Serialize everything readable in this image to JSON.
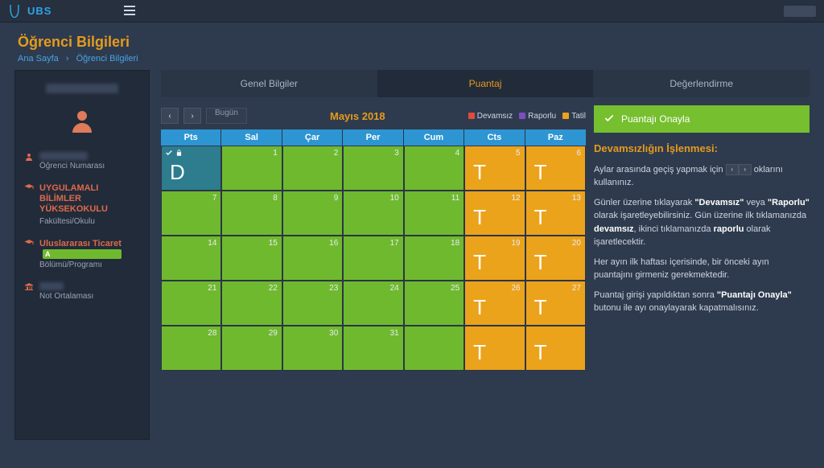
{
  "brand": "UBS",
  "page_title": "Öğrenci Bilgileri",
  "breadcrumb": {
    "home": "Ana Sayfa",
    "current": "Öğrenci Bilgileri"
  },
  "sidebar": {
    "student_number_label": "Öğrenci Numarası",
    "faculty_main": "UYGULAMALI BİLİMLER YÜKSEKOKULU",
    "faculty_sub": "Fakültesi/Okulu",
    "dept_main": "Uluslararası Ticaret",
    "dept_badge": "A",
    "dept_sub": "Bölümü/Programı",
    "gpa_sub": "Not Ortalaması"
  },
  "tabs": {
    "t1": "Genel Bilgiler",
    "t2": "Puantaj",
    "t3": "Değerlendirme"
  },
  "calendar": {
    "today_label": "Bugün",
    "title": "Mayıs 2018",
    "legend": {
      "devamsiz": "Devamsız",
      "raporlu": "Raporlu",
      "tatil": "Tatil"
    },
    "days": {
      "mon": "Pts",
      "tue": "Sal",
      "wed": "Çar",
      "thu": "Per",
      "fri": "Cum",
      "sat": "Cts",
      "sun": "Paz"
    },
    "cells": [
      {
        "n": "",
        "cls": "teal",
        "mark": "D",
        "lock": true
      },
      {
        "n": "1",
        "cls": "green"
      },
      {
        "n": "2",
        "cls": "green"
      },
      {
        "n": "3",
        "cls": "green"
      },
      {
        "n": "4",
        "cls": "green"
      },
      {
        "n": "5",
        "cls": "orange",
        "mark": "T"
      },
      {
        "n": "6",
        "cls": "orange",
        "mark": "T"
      },
      {
        "n": "7",
        "cls": "green"
      },
      {
        "n": "8",
        "cls": "green"
      },
      {
        "n": "9",
        "cls": "green"
      },
      {
        "n": "10",
        "cls": "green"
      },
      {
        "n": "11",
        "cls": "green"
      },
      {
        "n": "12",
        "cls": "orange",
        "mark": "T"
      },
      {
        "n": "13",
        "cls": "orange",
        "mark": "T"
      },
      {
        "n": "14",
        "cls": "green"
      },
      {
        "n": "15",
        "cls": "green"
      },
      {
        "n": "16",
        "cls": "green"
      },
      {
        "n": "17",
        "cls": "green"
      },
      {
        "n": "18",
        "cls": "green"
      },
      {
        "n": "19",
        "cls": "orange",
        "mark": "T"
      },
      {
        "n": "20",
        "cls": "orange",
        "mark": "T"
      },
      {
        "n": "21",
        "cls": "green"
      },
      {
        "n": "22",
        "cls": "green"
      },
      {
        "n": "23",
        "cls": "green"
      },
      {
        "n": "24",
        "cls": "green"
      },
      {
        "n": "25",
        "cls": "green"
      },
      {
        "n": "26",
        "cls": "orange",
        "mark": "T"
      },
      {
        "n": "27",
        "cls": "orange",
        "mark": "T"
      },
      {
        "n": "28",
        "cls": "green"
      },
      {
        "n": "29",
        "cls": "green"
      },
      {
        "n": "30",
        "cls": "green"
      },
      {
        "n": "31",
        "cls": "green"
      },
      {
        "n": "",
        "cls": "green"
      },
      {
        "n": "",
        "cls": "orange",
        "mark": "T"
      },
      {
        "n": "",
        "cls": "orange",
        "mark": "T"
      }
    ]
  },
  "approve_label": "Puantajı Onayla",
  "help": {
    "title": "Devamsızlığın İşlenmesi:",
    "p1a": "Aylar arasında geçiş yapmak için ",
    "p1b": " oklarını kullanınız.",
    "p2": "Günler üzerine tıklayarak \"Devamsız\" veya \"Raporlu\" olarak işaretleyebilirsiniz. Gün üzerine ilk tıklamanızda devamsız, ikinci tıklamanızda raporlu olarak işaretlecektir.",
    "p3": "Her ayın ilk haftası içerisinde, bir önceki ayın puantajını girmeniz gerekmektedir.",
    "p4": "Puantaj girişi yapıldıktan sonra \"Puantajı Onayla\" butonu ile ayı onaylayarak kapatmalısınız."
  }
}
